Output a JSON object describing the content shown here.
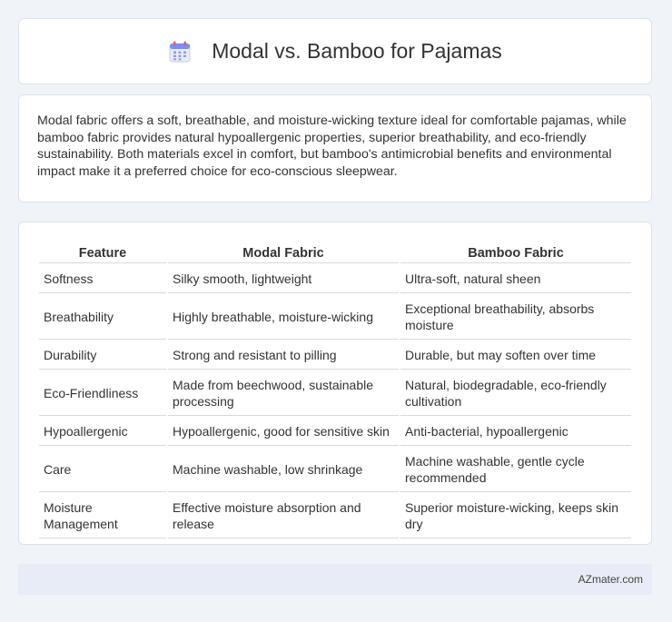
{
  "header": {
    "icon": "calendar-icon",
    "title": "Modal vs. Bamboo for Pajamas"
  },
  "intro": {
    "text": "Modal fabric offers a soft, breathable, and moisture-wicking texture ideal for comfortable pajamas, while bamboo fabric provides natural hypoallergenic properties, superior breathability, and eco-friendly sustainability. Both materials excel in comfort, but bamboo's antimicrobial benefits and environmental impact make it a preferred choice for eco-conscious sleepwear."
  },
  "table": {
    "headers": [
      "Feature",
      "Modal Fabric",
      "Bamboo Fabric"
    ],
    "rows": [
      [
        "Softness",
        "Silky smooth, lightweight",
        "Ultra-soft, natural sheen"
      ],
      [
        "Breathability",
        "Highly breathable, moisture-wicking",
        "Exceptional breathability, absorbs moisture"
      ],
      [
        "Durability",
        "Strong and resistant to pilling",
        "Durable, but may soften over time"
      ],
      [
        "Eco-Friendliness",
        "Made from beechwood, sustainable processing",
        "Natural, biodegradable, eco-friendly cultivation"
      ],
      [
        "Hypoallergenic",
        "Hypoallergenic, good for sensitive skin",
        "Anti-bacterial, hypoallergenic"
      ],
      [
        "Care",
        "Machine washable, low shrinkage",
        "Machine washable, gentle cycle recommended"
      ],
      [
        "Moisture Management",
        "Effective moisture absorption and release",
        "Superior moisture-wicking, keeps skin dry"
      ]
    ]
  },
  "footer": {
    "text": "AZmater.com"
  }
}
